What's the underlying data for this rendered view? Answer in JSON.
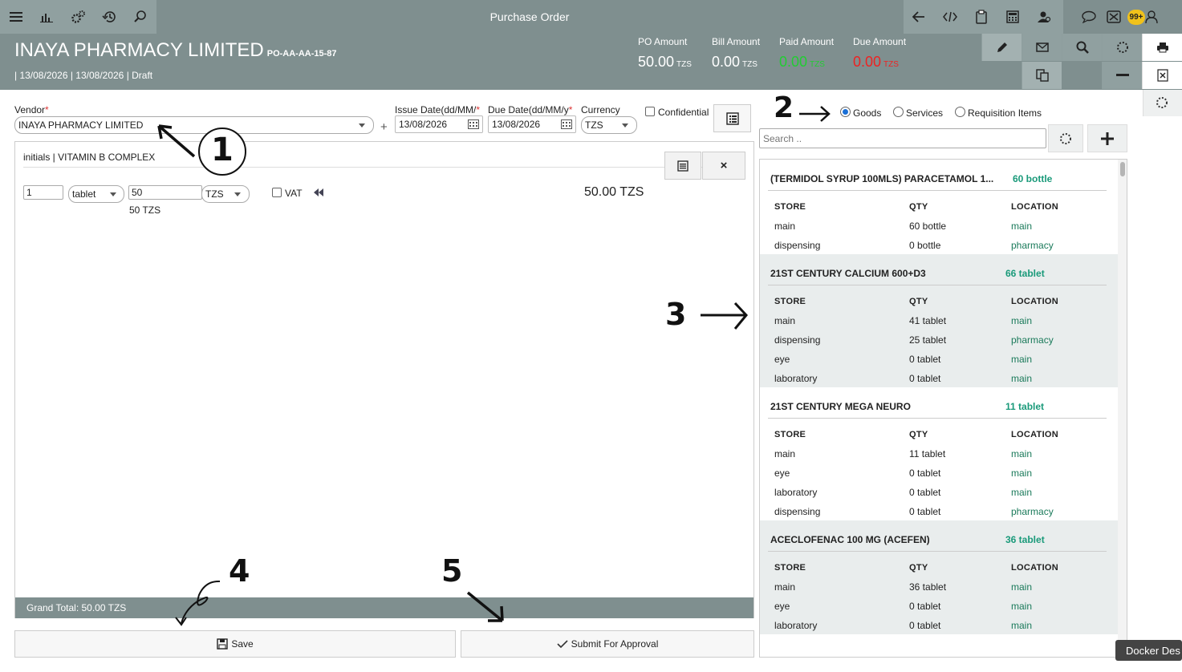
{
  "topbar": {
    "title": "Purchase Order",
    "notification_badge": "99+"
  },
  "header": {
    "company": "INAYA PHARMACY LIMITED",
    "po_code": "PO-AA-AA-15-87",
    "dates_status": "| 13/08/2026 | 13/08/2026 | Draft",
    "amounts": {
      "po_label": "PO Amount",
      "po_value": "50.00",
      "po_cur": "TZS",
      "bill_label": "Bill Amount",
      "bill_value": "0.00",
      "bill_cur": "TZS",
      "paid_label": "Paid Amount",
      "paid_value": "0.00",
      "paid_cur": "TZS",
      "due_label": "Due Amount",
      "due_value": "0.00",
      "due_cur": "TZS"
    }
  },
  "form": {
    "vendor_label": "Vendor",
    "vendor_value": "INAYA PHARMACY LIMITED",
    "issue_label": "Issue Date(dd/MM/",
    "issue_value": "13/08/2026",
    "due_label": "Due Date(dd/MM/y",
    "due_value": "13/08/2026",
    "currency_label": "Currency",
    "currency_value": "TZS",
    "confidential_label": "Confidential",
    "add_symbol": "+"
  },
  "line_item": {
    "title": "initials | VITAMIN B COMPLEX",
    "qty": "1",
    "unit": "tablet",
    "price": "50",
    "price_hint": "50 TZS",
    "currency": "TZS",
    "vat_label": "VAT",
    "total": "50.00 TZS",
    "close_symbol": "×"
  },
  "footer": {
    "grand_total": "Grand Total: 50.00 TZS",
    "save_label": "Save",
    "submit_label": "Submit For Approval"
  },
  "catalog": {
    "type_options": [
      "Goods",
      "Services",
      "Requisition Items"
    ],
    "selected_type": "Goods",
    "search_placeholder": "Search ..",
    "col_store": "STORE",
    "col_qty": "QTY",
    "col_location": "LOCATION",
    "products": [
      {
        "name": "(TERMIDOL SYRUP 100MLS) PARACETAMOL 1...",
        "stock": "60 bottle",
        "rows": [
          [
            "main",
            "60 bottle",
            "main"
          ],
          [
            "dispensing",
            "0 bottle",
            "pharmacy"
          ]
        ]
      },
      {
        "name": "21ST CENTURY CALCIUM 600+D3",
        "stock": "66 tablet",
        "rows": [
          [
            "main",
            "41 tablet",
            "main"
          ],
          [
            "dispensing",
            "25 tablet",
            "pharmacy"
          ],
          [
            "eye",
            "0 tablet",
            "main"
          ],
          [
            "laboratory",
            "0 tablet",
            "main"
          ]
        ]
      },
      {
        "name": "21ST CENTURY MEGA NEURO",
        "stock": "11 tablet",
        "rows": [
          [
            "main",
            "11 tablet",
            "main"
          ],
          [
            "eye",
            "0 tablet",
            "main"
          ],
          [
            "laboratory",
            "0 tablet",
            "main"
          ],
          [
            "dispensing",
            "0 tablet",
            "pharmacy"
          ]
        ]
      },
      {
        "name": "ACECLOFENAC 100 MG (ACEFEN)",
        "stock": "36 tablet",
        "rows": [
          [
            "main",
            "36 tablet",
            "main"
          ],
          [
            "eye",
            "0 tablet",
            "main"
          ],
          [
            "laboratory",
            "0 tablet",
            "main"
          ]
        ]
      }
    ]
  },
  "annotations": [
    "1",
    "2",
    "3",
    "4",
    "5"
  ],
  "dock_tooltip": "Docker Des",
  "colors": {
    "bar": "#7f8f8f",
    "green": "#1a9a7a",
    "paid_green": "#22cc33",
    "due_red": "#ee2222"
  }
}
